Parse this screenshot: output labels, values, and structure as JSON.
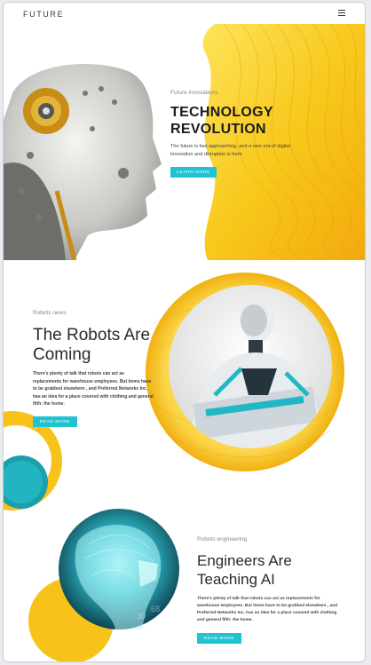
{
  "header": {
    "logo": "FUTURE",
    "menu_icon": "hamburger-icon"
  },
  "hero": {
    "kicker": "Future innovations",
    "title_line1": "TECHNOLOGY",
    "title_line2": "REVOLUTION",
    "text": "The future is fast approaching, and a new era of digital innovation and disruption is here.",
    "button": "LEARN MORE"
  },
  "section2": {
    "kicker": "Robots news",
    "title": "The Robots Are Coming",
    "text": "There's plenty of talk that robots can act as replacements for warehouse employees. But items have to be grabbed elsewhere , and Preferred Networks Inc. has an idea for a place covered with clothing and general filth: the home.",
    "button": "READ MORE"
  },
  "section3": {
    "kicker": "Robots engineering",
    "title": "Engineers Are Teaching AI",
    "text": "There's plenty of talk that robots can act as replacements for warehouse employees. But items have to be grabbed elsewhere , and Preferred Networks Inc. has an idea for a place covered with clothing and general filth: the home.",
    "button": "READ MORE"
  },
  "colors": {
    "accent_yellow": "#f6c21a",
    "accent_cyan": "#1fc3d2",
    "text_dark": "#1b1b1b"
  }
}
